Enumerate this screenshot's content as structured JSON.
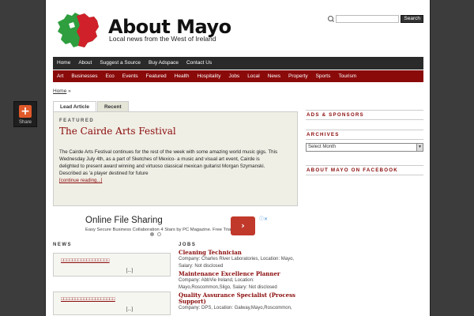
{
  "share": {
    "label": "Share",
    "icon": "plus-icon"
  },
  "header": {
    "title": "About Mayo",
    "description": "Local news from the West of Ireland",
    "search_button": "Search",
    "search_placeholder": ""
  },
  "topnav": [
    "Home",
    "About",
    "Suggest a Source",
    "Buy Adspace",
    "Contact Us"
  ],
  "catnav": [
    "Art",
    "Businesses",
    "Eco",
    "Events",
    "Featured",
    "Health",
    "Hospitality",
    "Jobs",
    "Local",
    "News",
    "Property",
    "Sports",
    "Tourism"
  ],
  "breadcrumb": {
    "home": "Home",
    "sep": "»"
  },
  "lead": {
    "tabs": [
      "Lead Article",
      "Recent"
    ],
    "label": "FEATURED",
    "title": "The Cairde Arts Festival",
    "text": "The Cairde Arts Festival continues for the rest of the week with some amazing world music gigs. This Wednesday July 4th, as a part of Sketches of Mexico- a music and visual art event, Cairde is delighted to present award winning and virtuoso classical mexican guitarist Morgan Szymanski. Described as 'a player destined for future",
    "more": "[continue reading...]"
  },
  "ad": {
    "title": "Online File Sharing",
    "subtitle": "Easy Secure Business Collaboration 4 Stars by PC Magazine. Free Trial",
    "button": "›",
    "close": "ⓘ✕"
  },
  "news": {
    "heading": "NEWS",
    "items": [
      {
        "title": "□□□□□□□□□□□□□□□□□",
        "more": "[...]"
      },
      {
        "title": "□□□□□□□□□□□□□□□□□□□",
        "more": "[...]"
      }
    ]
  },
  "jobs": {
    "heading": "JOBS",
    "items": [
      {
        "title": "Cleaning Technician",
        "meta": "Company: Charles River Laboratories, Location: Mayo, Salary: Not disclosed"
      },
      {
        "title": "Maintenance Excellence Planner",
        "meta": "Company: AbbVie Ireland, Location: Mayo,Roscommon,Sligo, Salary: Not disclosed"
      },
      {
        "title": "Quality Assurance Specialist (Process Support)",
        "meta": "Company: DPS, Location: Galway,Mayo,Roscommon,"
      }
    ]
  },
  "sidebar": {
    "ads_heading": "ADS & SPONSORS",
    "archives_heading": "ARCHIVES",
    "archives_select": "Select Month",
    "facebook_heading": "ABOUT MAYO ON FACEBOOK"
  },
  "colors": {
    "accent": "#8a0a0a",
    "nav": "#2a2a2a",
    "map_green": "#2e9e3e",
    "map_red": "#d0202a"
  }
}
